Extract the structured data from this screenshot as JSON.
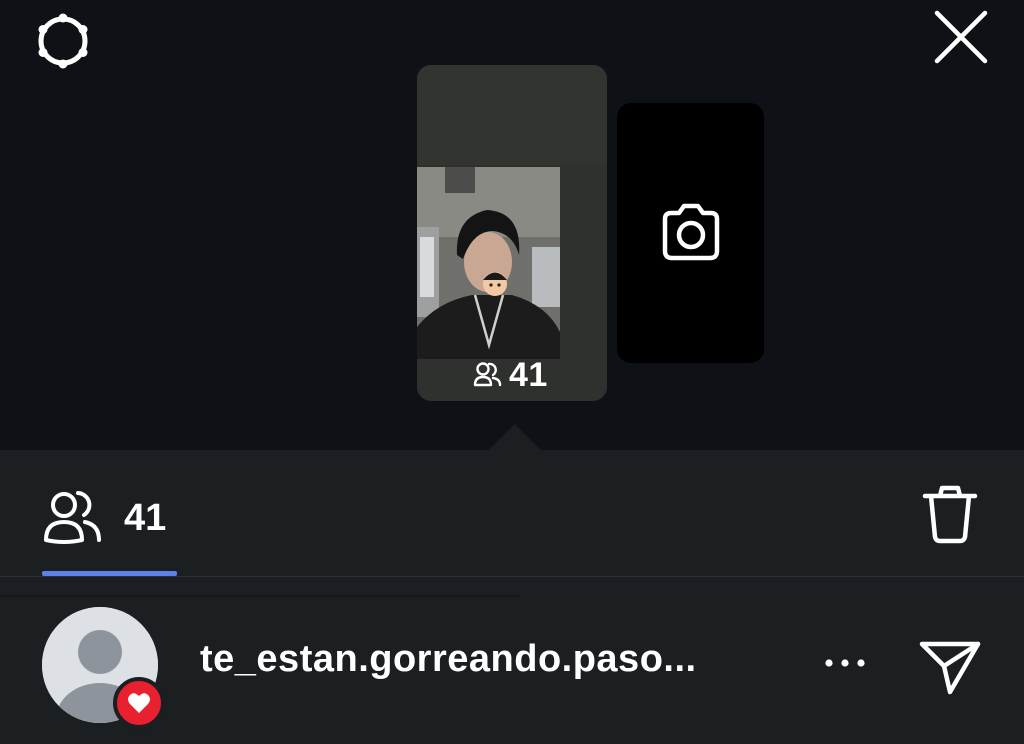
{
  "header": {
    "settings_icon": "settings-gear-icon",
    "close_icon": "close-icon"
  },
  "stories": {
    "current": {
      "viewer_icon": "viewers-icon",
      "viewer_count": "41"
    },
    "new_story_icon": "camera-icon"
  },
  "viewers_panel": {
    "tab": {
      "icon": "viewers-icon",
      "count": "41"
    },
    "delete_icon": "trash-icon",
    "viewers": [
      {
        "username": "te_estan.gorreando.paso...",
        "reaction": "heart",
        "more_icon": "more-icon",
        "send_icon": "send-icon"
      }
    ]
  },
  "colors": {
    "background": "#0e1216",
    "panel": "#1b1f22",
    "tab_underline": "#5b82e6",
    "heart_badge": "#e8202f"
  }
}
